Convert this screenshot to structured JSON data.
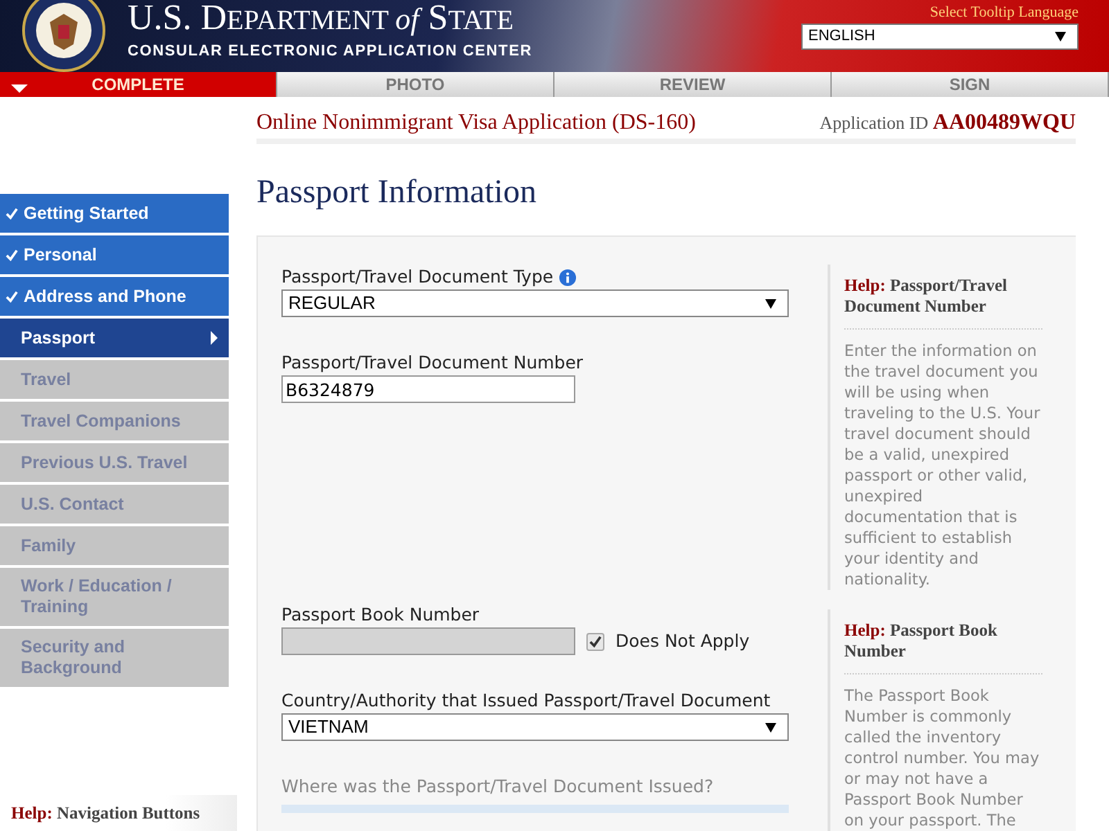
{
  "header": {
    "title_start": "U.S. D",
    "title_mid": "EPARTMENT ",
    "title_of": "of",
    "title_end": " S",
    "title_tail": "TATE",
    "subtitle": "CONSULAR ELECTRONIC APPLICATION CENTER",
    "language_label": "Select Tooltip Language",
    "language": "ENGLISH"
  },
  "steps": [
    {
      "label": "COMPLETE",
      "selected": true
    },
    {
      "label": "PHOTO",
      "selected": false
    },
    {
      "label": "REVIEW",
      "selected": false
    },
    {
      "label": "SIGN",
      "selected": false
    }
  ],
  "app_title": "Online Nonimmigrant Visa Application (DS-160)",
  "app_id_label": "Application ID",
  "app_id": "AA00489WQU",
  "page_title": "Passport Information",
  "sidebar": [
    {
      "label": "Getting Started",
      "completed": true,
      "selected": false
    },
    {
      "label": "Personal",
      "completed": true,
      "selected": false
    },
    {
      "label": "Address and Phone",
      "completed": true,
      "selected": false
    },
    {
      "label": "Passport",
      "completed": false,
      "selected": true
    },
    {
      "label": "Travel",
      "completed": false,
      "selected": false
    },
    {
      "label": "Travel Companions",
      "completed": false,
      "selected": false
    },
    {
      "label": "Previous U.S. Travel",
      "completed": false,
      "selected": false
    },
    {
      "label": "U.S. Contact",
      "completed": false,
      "selected": false
    },
    {
      "label": "Family",
      "completed": false,
      "selected": false
    },
    {
      "label": "Work / Education / Training",
      "completed": false,
      "selected": false
    },
    {
      "label": "Security and Background",
      "completed": false,
      "selected": false
    }
  ],
  "sidebar_help": {
    "prefix": "Help:",
    "title": "Navigation Buttons"
  },
  "fields": [
    {
      "kind": "select",
      "label": "Passport/Travel Document Type",
      "info": true,
      "value": "REGULAR"
    },
    {
      "kind": "text",
      "label": "Passport/Travel Document Number",
      "value": "B6324879",
      "disabled": false
    },
    {
      "kind": "text",
      "label": "Passport Book Number",
      "disabled": true,
      "checkbox": {
        "label": "Does Not Apply",
        "checked": true
      }
    },
    {
      "kind": "select",
      "label": "Country/Authority that Issued Passport/Travel Document",
      "info": false,
      "value": "VIETNAM"
    },
    {
      "kind": "heading",
      "label": "Where was the Passport/Travel Document Issued?"
    }
  ],
  "help": [
    {
      "prefix": "Help:",
      "title": "Passport/Travel Document Number",
      "text": "Enter the information on the travel document you will be using when traveling to the U.S. Your travel document should be a valid, unexpired passport or other valid, unexpired documentation that is sufficient to establish your identity and nationality."
    },
    {
      "prefix": "Help:",
      "title": "Passport Book Number",
      "text": "The Passport Book Number is commonly called the inventory control number. You may or may not have a Passport Book Number on your passport. The"
    }
  ]
}
